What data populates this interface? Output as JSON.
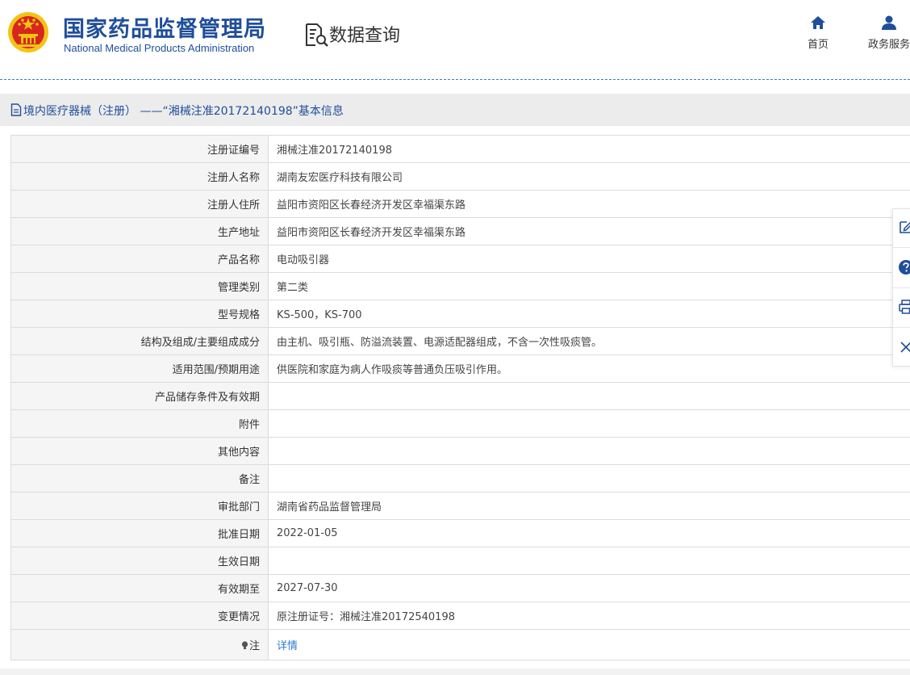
{
  "header": {
    "org_name_cn": "国家药品监督管理局",
    "org_name_en": "National Medical Products Administration",
    "page_title": "数据查询",
    "nav": [
      {
        "label": "首页",
        "icon": "home-icon"
      },
      {
        "label": "政务服务",
        "icon": "user-icon"
      }
    ]
  },
  "titlebar": {
    "text": "境内医疗器械（注册） ——“湘械注准20172140198”基本信息"
  },
  "record": {
    "rows": [
      {
        "label": "注册证编号",
        "value": "湘械注准20172140198"
      },
      {
        "label": "注册人名称",
        "value": "湖南友宏医疗科技有限公司"
      },
      {
        "label": "注册人住所",
        "value": "益阳市资阳区长春经济开发区幸福渠东路"
      },
      {
        "label": "生产地址",
        "value": "益阳市资阳区长春经济开发区幸福渠东路"
      },
      {
        "label": "产品名称",
        "value": "电动吸引器"
      },
      {
        "label": "管理类别",
        "value": "第二类"
      },
      {
        "label": "型号规格",
        "value": "KS-500，KS-700"
      },
      {
        "label": "结构及组成/主要组成成分",
        "value": "由主机、吸引瓶、防溢流装置、电源适配器组成，不含一次性吸痰管。"
      },
      {
        "label": "适用范围/预期用途",
        "value": "供医院和家庭为病人作吸痰等普通负压吸引作用。"
      },
      {
        "label": "产品储存条件及有效期",
        "value": ""
      },
      {
        "label": "附件",
        "value": ""
      },
      {
        "label": "其他内容",
        "value": ""
      },
      {
        "label": "备注",
        "value": ""
      },
      {
        "label": "审批部门",
        "value": "湖南省药品监督管理局"
      },
      {
        "label": "批准日期",
        "value": "2022-01-05"
      },
      {
        "label": "生效日期",
        "value": ""
      },
      {
        "label": "有效期至",
        "value": "2027-07-30"
      },
      {
        "label": "变更情况",
        "value": "原注册证号：湘械注准20172540198"
      }
    ],
    "note_label": "注",
    "note_link": "详情"
  },
  "side_toolbar": {
    "icons": [
      "edit-icon",
      "help-icon",
      "print-icon",
      "close-icon"
    ]
  },
  "colors": {
    "brand_blue": "#1f4e9a",
    "link_blue": "#2f7bd4",
    "emblem_red": "#d7261e",
    "emblem_gold": "#f3c316"
  }
}
